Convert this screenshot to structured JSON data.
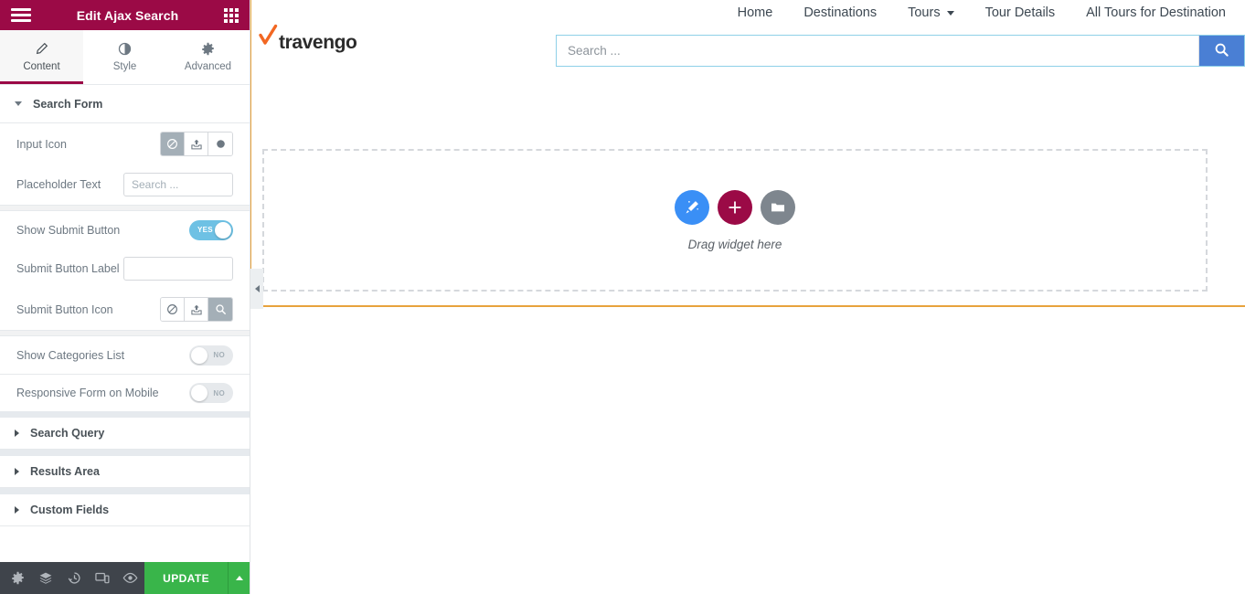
{
  "panel": {
    "header": {
      "title": "Edit Ajax Search",
      "menu_icon": "hamburger-icon",
      "grid_icon": "widgets-grid-icon"
    },
    "tabs": [
      {
        "label": "Content",
        "icon": "pencil-icon",
        "active": true
      },
      {
        "label": "Style",
        "icon": "contrast-circle-icon",
        "active": false
      },
      {
        "label": "Advanced",
        "icon": "gear-icon",
        "active": false
      }
    ],
    "sections": [
      {
        "label": "Search Form",
        "expanded": true
      },
      {
        "label": "Search Query",
        "expanded": false
      },
      {
        "label": "Results Area",
        "expanded": false
      },
      {
        "label": "Custom Fields",
        "expanded": false
      }
    ],
    "controls": {
      "input_icon": {
        "label": "Input Icon",
        "choices": [
          {
            "name": "none-icon",
            "active": true
          },
          {
            "name": "upload-media-icon",
            "active": false
          },
          {
            "name": "icon-library-circle-icon",
            "active": false
          }
        ]
      },
      "placeholder_text": {
        "label": "Placeholder Text",
        "value": "",
        "placeholder": "Search ..."
      },
      "show_submit_button": {
        "label": "Show Submit Button",
        "state": "YES",
        "on": true
      },
      "submit_button_label": {
        "label": "Submit Button Label",
        "value": "",
        "placeholder": ""
      },
      "submit_button_icon": {
        "label": "Submit Button Icon",
        "choices": [
          {
            "name": "none-icon",
            "active": false
          },
          {
            "name": "upload-media-icon",
            "active": false
          },
          {
            "name": "search-magnifier-icon",
            "active": true
          }
        ]
      },
      "show_categories_list": {
        "label": "Show Categories List",
        "state": "NO",
        "on": false
      },
      "responsive_form_on_mobile": {
        "label": "Responsive Form on Mobile",
        "state": "NO",
        "on": false
      }
    },
    "footer": {
      "buttons": [
        {
          "name": "settings-gear-icon"
        },
        {
          "name": "navigator-layers-icon"
        },
        {
          "name": "history-clock-icon"
        },
        {
          "name": "responsive-mode-icon"
        },
        {
          "name": "preview-eye-icon"
        }
      ],
      "update_label": "UPDATE",
      "update_caret": "chevron-up-icon"
    }
  },
  "canvas": {
    "site": {
      "logo_text": "travengo",
      "logo_mark": "orange-check-icon",
      "nav": [
        {
          "label": "Home",
          "has_dropdown": false
        },
        {
          "label": "Destinations",
          "has_dropdown": false
        },
        {
          "label": "Tours",
          "has_dropdown": true
        },
        {
          "label": "Tour Details",
          "has_dropdown": false
        },
        {
          "label": "All Tours for Destination",
          "has_dropdown": false
        }
      ],
      "search": {
        "value": "",
        "placeholder": "Search ...",
        "button_icon": "search-magnifier-icon"
      }
    },
    "dropzone": {
      "text": "Drag widget here",
      "buttons": [
        {
          "name": "add-template-magic-icon"
        },
        {
          "name": "add-section-plus-icon"
        },
        {
          "name": "add-folder-icon"
        }
      ]
    },
    "collapse_handle_icon": "chevron-left-icon"
  },
  "colors": {
    "brand": "#9b0a46",
    "accent_blue": "#6ec1e4",
    "update_green": "#39b54a",
    "section_outline": "#e8a33d",
    "submit_blue": "#4a7fd4"
  }
}
